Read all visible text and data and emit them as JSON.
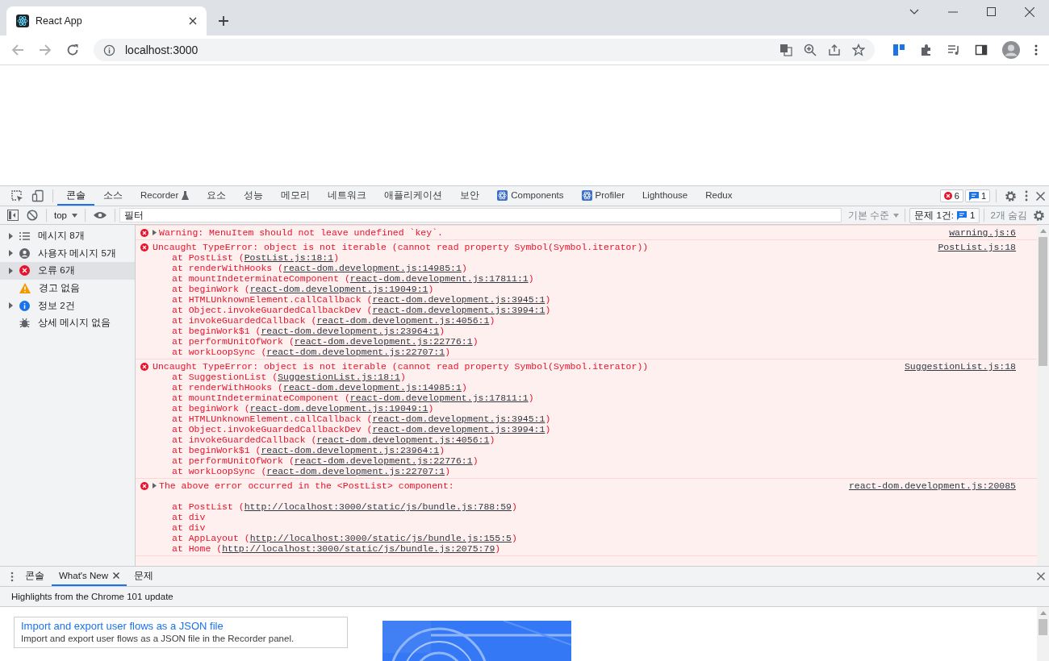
{
  "browser": {
    "tab": {
      "title": "React App"
    },
    "address": "localhost:3000"
  },
  "devtools": {
    "tabs": [
      {
        "label": "콘솔",
        "kind": "plain",
        "selected": true
      },
      {
        "label": "소스",
        "kind": "plain",
        "selected": false
      },
      {
        "label": "Recorder",
        "kind": "experimental",
        "selected": false
      },
      {
        "label": "요소",
        "kind": "plain",
        "selected": false
      },
      {
        "label": "성능",
        "kind": "plain",
        "selected": false
      },
      {
        "label": "메모리",
        "kind": "plain",
        "selected": false
      },
      {
        "label": "네트워크",
        "kind": "plain",
        "selected": false
      },
      {
        "label": "애플리케이션",
        "kind": "plain",
        "selected": false
      },
      {
        "label": "보안",
        "kind": "plain",
        "selected": false
      },
      {
        "label": "Components",
        "kind": "extension",
        "selected": false
      },
      {
        "label": "Profiler",
        "kind": "extension",
        "selected": false
      },
      {
        "label": "Lighthouse",
        "kind": "plain",
        "selected": false
      },
      {
        "label": "Redux",
        "kind": "plain",
        "selected": false
      }
    ],
    "error_count": "6",
    "issue_count": "1"
  },
  "console_toolbar": {
    "context": "top",
    "filter_placeholder": "필터",
    "level": "기본 수준",
    "issues_label": "문제 1건:",
    "issues_count": "1",
    "hidden": "2개 숨김"
  },
  "sidebar": [
    {
      "label": "메시지 8개",
      "kind": "all",
      "expandable": true,
      "selected": false
    },
    {
      "label": "사용자 메시지 5개",
      "kind": "user",
      "expandable": true,
      "selected": false
    },
    {
      "label": "오류 6개",
      "kind": "error",
      "expandable": true,
      "selected": true
    },
    {
      "label": "경고 없음",
      "kind": "warning",
      "expandable": false,
      "selected": false
    },
    {
      "label": "정보 2건",
      "kind": "info",
      "expandable": true,
      "selected": false
    },
    {
      "label": "상세 메시지 없음",
      "kind": "verbose",
      "expandable": false,
      "selected": false
    }
  ],
  "messages": [
    {
      "expandable": true,
      "text": "Warning: MenuItem should not leave undefined `key`.",
      "source": "warning.js:6",
      "gap_before_frames": false
    },
    {
      "expandable": false,
      "text": "Uncaught TypeError: object is not iterable (cannot read property Symbol(Symbol.iterator))",
      "source": "PostList.js:18",
      "gap_before_frames": false,
      "frames": [
        {
          "pre": "at PostList (",
          "link": "PostList.js:18:1",
          "post": ")"
        },
        {
          "pre": "at renderWithHooks (",
          "link": "react-dom.development.js:14985:1",
          "post": ")"
        },
        {
          "pre": "at mountIndeterminateComponent (",
          "link": "react-dom.development.js:17811:1",
          "post": ")"
        },
        {
          "pre": "at beginWork (",
          "link": "react-dom.development.js:19049:1",
          "post": ")"
        },
        {
          "pre": "at HTMLUnknownElement.callCallback (",
          "link": "react-dom.development.js:3945:1",
          "post": ")"
        },
        {
          "pre": "at Object.invokeGuardedCallbackDev (",
          "link": "react-dom.development.js:3994:1",
          "post": ")"
        },
        {
          "pre": "at invokeGuardedCallback (",
          "link": "react-dom.development.js:4056:1",
          "post": ")"
        },
        {
          "pre": "at beginWork$1 (",
          "link": "react-dom.development.js:23964:1",
          "post": ")"
        },
        {
          "pre": "at performUnitOfWork (",
          "link": "react-dom.development.js:22776:1",
          "post": ")"
        },
        {
          "pre": "at workLoopSync (",
          "link": "react-dom.development.js:22707:1",
          "post": ")"
        }
      ]
    },
    {
      "expandable": false,
      "text": "Uncaught TypeError: object is not iterable (cannot read property Symbol(Symbol.iterator))",
      "source": "SuggestionList.js:18",
      "gap_before_frames": false,
      "frames": [
        {
          "pre": "at SuggestionList (",
          "link": "SuggestionList.js:18:1",
          "post": ")"
        },
        {
          "pre": "at renderWithHooks (",
          "link": "react-dom.development.js:14985:1",
          "post": ")"
        },
        {
          "pre": "at mountIndeterminateComponent (",
          "link": "react-dom.development.js:17811:1",
          "post": ")"
        },
        {
          "pre": "at beginWork (",
          "link": "react-dom.development.js:19049:1",
          "post": ")"
        },
        {
          "pre": "at HTMLUnknownElement.callCallback (",
          "link": "react-dom.development.js:3945:1",
          "post": ")"
        },
        {
          "pre": "at Object.invokeGuardedCallbackDev (",
          "link": "react-dom.development.js:3994:1",
          "post": ")"
        },
        {
          "pre": "at invokeGuardedCallback (",
          "link": "react-dom.development.js:4056:1",
          "post": ")"
        },
        {
          "pre": "at beginWork$1 (",
          "link": "react-dom.development.js:23964:1",
          "post": ")"
        },
        {
          "pre": "at performUnitOfWork (",
          "link": "react-dom.development.js:22776:1",
          "post": ")"
        },
        {
          "pre": "at workLoopSync (",
          "link": "react-dom.development.js:22707:1",
          "post": ")"
        }
      ]
    },
    {
      "expandable": true,
      "text": "The above error occurred in the <PostList> component:",
      "source": "react-dom.development.js:20085",
      "gap_before_frames": true,
      "frames": [
        {
          "pre": "at PostList (",
          "link": "http://localhost:3000/static/js/bundle.js:788:59",
          "post": ")"
        },
        {
          "pre": "at div"
        },
        {
          "pre": "at div"
        },
        {
          "pre": "at AppLayout (",
          "link": "http://localhost:3000/static/js/bundle.js:155:5",
          "post": ")"
        },
        {
          "pre": "at Home (",
          "link": "http://localhost:3000/static/js/bundle.js:2075:79",
          "post": ")"
        }
      ]
    }
  ],
  "drawer": {
    "tabs": [
      {
        "label": "콘솔",
        "closable": false,
        "selected": false
      },
      {
        "label": "What's New",
        "closable": true,
        "selected": true
      },
      {
        "label": "문제",
        "closable": false,
        "selected": false
      }
    ],
    "heading": "Highlights from the Chrome 101 update",
    "cards": [
      {
        "title": "Import and export user flows as a JSON file",
        "description": "Import and export user flows as a JSON file in the Recorder panel."
      }
    ]
  }
}
